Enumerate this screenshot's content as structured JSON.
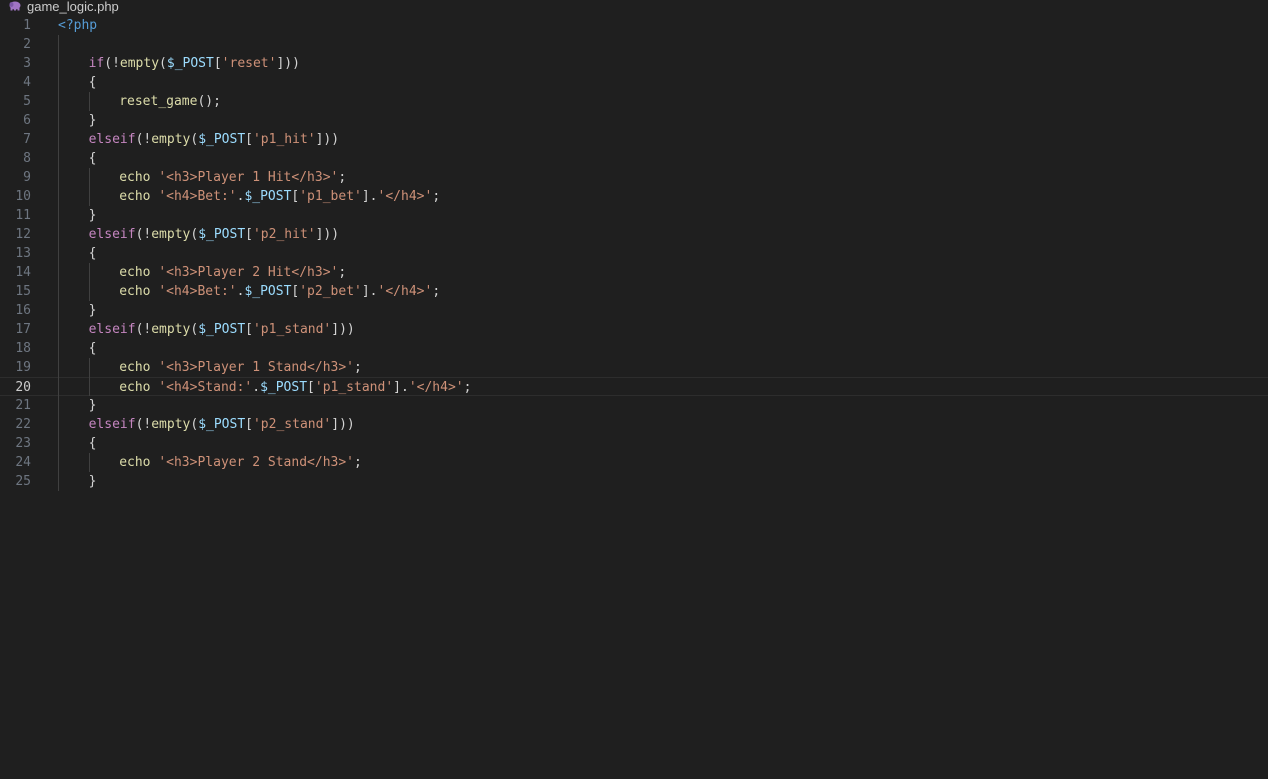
{
  "tab": {
    "filename": "game_logic.php",
    "icon": "php-elephant-icon"
  },
  "editor": {
    "current_line": 20,
    "lines": [
      {
        "n": "1",
        "indent": 0,
        "tokens": [
          [
            "php",
            "<?php"
          ]
        ]
      },
      {
        "n": "2",
        "indent": 0,
        "tokens": []
      },
      {
        "n": "3",
        "indent": 1,
        "tokens": [
          [
            "kw",
            "if"
          ],
          [
            "plain",
            "(!"
          ],
          [
            "fn",
            "empty"
          ],
          [
            "plain",
            "("
          ],
          [
            "var",
            "$_POST"
          ],
          [
            "plain",
            "["
          ],
          [
            "str",
            "'reset'"
          ],
          [
            "plain",
            "]))"
          ]
        ]
      },
      {
        "n": "4",
        "indent": 1,
        "tokens": [
          [
            "plain",
            "{"
          ]
        ]
      },
      {
        "n": "5",
        "indent": 2,
        "tokens": [
          [
            "fn",
            "reset_game"
          ],
          [
            "plain",
            "();"
          ]
        ]
      },
      {
        "n": "6",
        "indent": 1,
        "tokens": [
          [
            "plain",
            "}"
          ]
        ]
      },
      {
        "n": "7",
        "indent": 1,
        "tokens": [
          [
            "kw",
            "elseif"
          ],
          [
            "plain",
            "(!"
          ],
          [
            "fn",
            "empty"
          ],
          [
            "plain",
            "("
          ],
          [
            "var",
            "$_POST"
          ],
          [
            "plain",
            "["
          ],
          [
            "str",
            "'p1_hit'"
          ],
          [
            "plain",
            "]))"
          ]
        ]
      },
      {
        "n": "8",
        "indent": 1,
        "tokens": [
          [
            "plain",
            "{"
          ]
        ]
      },
      {
        "n": "9",
        "indent": 2,
        "tokens": [
          [
            "fn",
            "echo"
          ],
          [
            "plain",
            " "
          ],
          [
            "str",
            "'<h3>Player 1 Hit</h3>'"
          ],
          [
            "plain",
            ";"
          ]
        ]
      },
      {
        "n": "10",
        "indent": 2,
        "tokens": [
          [
            "fn",
            "echo"
          ],
          [
            "plain",
            " "
          ],
          [
            "str",
            "'<h4>Bet:'"
          ],
          [
            "plain",
            "."
          ],
          [
            "var",
            "$_POST"
          ],
          [
            "plain",
            "["
          ],
          [
            "str",
            "'p1_bet'"
          ],
          [
            "plain",
            "]."
          ],
          [
            "str",
            "'</h4>'"
          ],
          [
            "plain",
            ";"
          ]
        ]
      },
      {
        "n": "11",
        "indent": 1,
        "tokens": [
          [
            "plain",
            "}"
          ]
        ]
      },
      {
        "n": "12",
        "indent": 1,
        "tokens": [
          [
            "kw",
            "elseif"
          ],
          [
            "plain",
            "(!"
          ],
          [
            "fn",
            "empty"
          ],
          [
            "plain",
            "("
          ],
          [
            "var",
            "$_POST"
          ],
          [
            "plain",
            "["
          ],
          [
            "str",
            "'p2_hit'"
          ],
          [
            "plain",
            "]))"
          ]
        ]
      },
      {
        "n": "13",
        "indent": 1,
        "tokens": [
          [
            "plain",
            "{"
          ]
        ]
      },
      {
        "n": "14",
        "indent": 2,
        "tokens": [
          [
            "fn",
            "echo"
          ],
          [
            "plain",
            " "
          ],
          [
            "str",
            "'<h3>Player 2 Hit</h3>'"
          ],
          [
            "plain",
            ";"
          ]
        ]
      },
      {
        "n": "15",
        "indent": 2,
        "tokens": [
          [
            "fn",
            "echo"
          ],
          [
            "plain",
            " "
          ],
          [
            "str",
            "'<h4>Bet:'"
          ],
          [
            "plain",
            "."
          ],
          [
            "var",
            "$_POST"
          ],
          [
            "plain",
            "["
          ],
          [
            "str",
            "'p2_bet'"
          ],
          [
            "plain",
            "]."
          ],
          [
            "str",
            "'</h4>'"
          ],
          [
            "plain",
            ";"
          ]
        ]
      },
      {
        "n": "16",
        "indent": 1,
        "tokens": [
          [
            "plain",
            "}"
          ]
        ]
      },
      {
        "n": "17",
        "indent": 1,
        "tokens": [
          [
            "kw",
            "elseif"
          ],
          [
            "plain",
            "(!"
          ],
          [
            "fn",
            "empty"
          ],
          [
            "plain",
            "("
          ],
          [
            "var",
            "$_POST"
          ],
          [
            "plain",
            "["
          ],
          [
            "str",
            "'p1_stand'"
          ],
          [
            "plain",
            "]))"
          ]
        ]
      },
      {
        "n": "18",
        "indent": 1,
        "tokens": [
          [
            "plain",
            "{"
          ]
        ]
      },
      {
        "n": "19",
        "indent": 2,
        "tokens": [
          [
            "fn",
            "echo"
          ],
          [
            "plain",
            " "
          ],
          [
            "str",
            "'<h3>Player 1 Stand</h3>'"
          ],
          [
            "plain",
            ";"
          ]
        ]
      },
      {
        "n": "20",
        "indent": 2,
        "tokens": [
          [
            "fn",
            "echo"
          ],
          [
            "plain",
            " "
          ],
          [
            "str",
            "'<h4>Stand:'"
          ],
          [
            "plain",
            "."
          ],
          [
            "var",
            "$_POST"
          ],
          [
            "plain",
            "["
          ],
          [
            "str",
            "'p1_stand'"
          ],
          [
            "plain",
            "]."
          ],
          [
            "str",
            "'</h4>'"
          ],
          [
            "plain",
            ";"
          ]
        ]
      },
      {
        "n": "21",
        "indent": 1,
        "tokens": [
          [
            "plain",
            "}"
          ]
        ]
      },
      {
        "n": "22",
        "indent": 1,
        "tokens": [
          [
            "kw",
            "elseif"
          ],
          [
            "plain",
            "(!"
          ],
          [
            "fn",
            "empty"
          ],
          [
            "plain",
            "("
          ],
          [
            "var",
            "$_POST"
          ],
          [
            "plain",
            "["
          ],
          [
            "str",
            "'p2_stand'"
          ],
          [
            "plain",
            "]))"
          ]
        ]
      },
      {
        "n": "23",
        "indent": 1,
        "tokens": [
          [
            "plain",
            "{"
          ]
        ]
      },
      {
        "n": "24",
        "indent": 2,
        "tokens": [
          [
            "fn",
            "echo"
          ],
          [
            "plain",
            " "
          ],
          [
            "str",
            "'<h3>Player 2 Stand</h3>'"
          ],
          [
            "plain",
            ";"
          ]
        ]
      },
      {
        "n": "25",
        "indent": 1,
        "tokens": [
          [
            "plain",
            "}"
          ]
        ]
      }
    ]
  },
  "colors": {
    "background": "#1f1f1f",
    "keyword": "#c586c0",
    "php_tag": "#569cd6",
    "function": "#dcdcaa",
    "variable": "#9cdcfe",
    "string": "#ce9178",
    "text": "#d4d4d4",
    "line_number": "#6e7681",
    "tab_icon": "#a074c4"
  }
}
